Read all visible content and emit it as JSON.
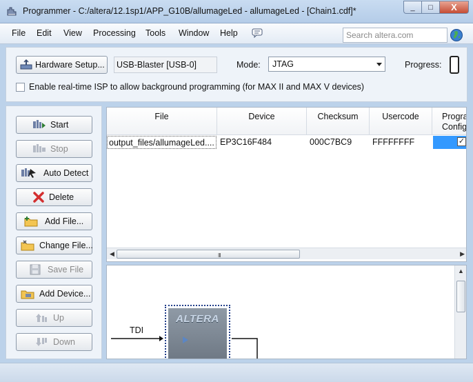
{
  "window": {
    "title": "Programmer - C:/altera/12.1sp1/APP_G10B/allumageLed - allumageLed - [Chain1.cdf]*",
    "minimize_glyph": "_",
    "maximize_glyph": "□",
    "close_glyph": "X"
  },
  "menu": {
    "items": [
      "File",
      "Edit",
      "View",
      "Processing",
      "Tools",
      "Window",
      "Help"
    ],
    "search_placeholder": "Search altera.com"
  },
  "toolbar": {
    "hardware_setup_label": "Hardware Setup...",
    "hardware_value": "USB-Blaster [USB-0]",
    "mode_label": "Mode:",
    "mode_value": "JTAG",
    "progress_label": "Progress:",
    "isp_checked": false,
    "isp_label": "Enable real-time ISP to allow background programming (for MAX II and MAX V devices)"
  },
  "side_buttons": {
    "start": "Start",
    "stop": "Stop",
    "auto_detect": "Auto Detect",
    "delete": "Delete",
    "add_file": "Add File...",
    "change_file": "Change File...",
    "save_file": "Save File",
    "add_device": "Add Device...",
    "up": "Up",
    "down": "Down"
  },
  "table": {
    "columns": {
      "file": "File",
      "device": "Device",
      "checksum": "Checksum",
      "usercode": "Usercode",
      "prog_line1": "Progra",
      "prog_line2": "Config"
    },
    "rows": [
      {
        "file": "output_files/allumageLed....",
        "device": "EP3C16F484",
        "checksum": "000C7BC9",
        "usercode": "FFFFFFFF",
        "program_configure": true
      }
    ],
    "scroll_grip": "III"
  },
  "diagram": {
    "tdi_label": "TDI",
    "chip_logo": "ALTERA"
  },
  "colors": {
    "selection": "#3399ff",
    "chip_border": "#1f3c88"
  }
}
